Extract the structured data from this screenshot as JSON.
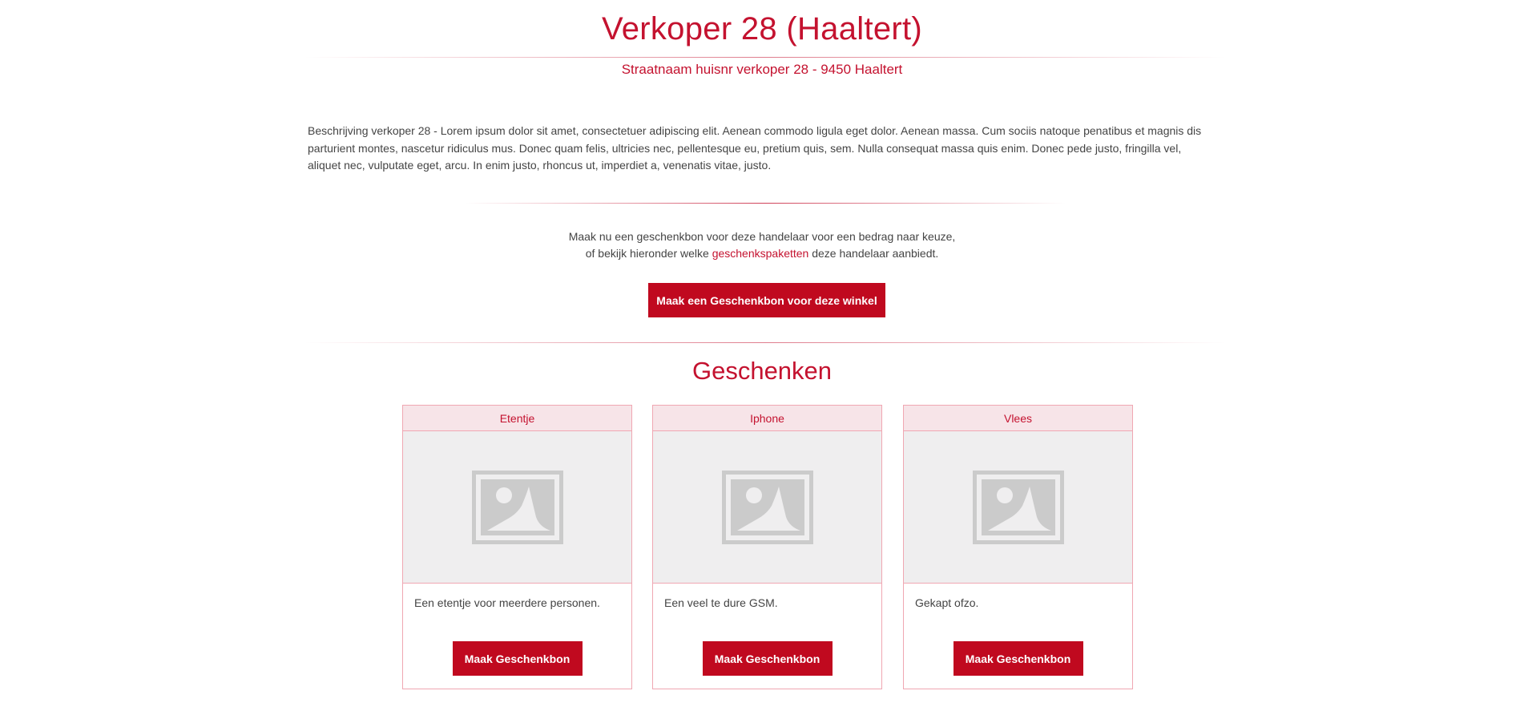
{
  "store": {
    "title": "Verkoper 28 (Haaltert)",
    "address": "Straatnaam huisnr verkoper 28 - 9450 Haaltert",
    "description": "Beschrijving verkoper 28 - Lorem ipsum dolor sit amet, consectetuer adipiscing elit. Aenean commodo ligula eget dolor. Aenean massa. Cum sociis natoque penatibus et magnis dis parturient montes, nascetur ridiculus mus. Donec quam felis, ultricies nec, pellentesque eu, pretium quis, sem. Nulla consequat massa quis enim. Donec pede justo, fringilla vel, aliquet nec, vulputate eget, arcu. In enim justo, rhoncus ut, imperdiet a, venenatis vitae, justo."
  },
  "cta": {
    "line1": "Maak nu een geschenkbon voor deze handelaar voor een bedrag naar keuze,",
    "line2_prefix": "of bekijk hieronder welke ",
    "line2_link": "geschenkspaketten",
    "line2_suffix": " deze handelaar aanbiedt.",
    "button_label": "Maak een Geschenkbon voor deze winkel"
  },
  "gifts": {
    "section_title": "Geschenken",
    "items": [
      {
        "title": "Etentje",
        "description": "Een etentje voor meerdere personen.",
        "image_icon": "image-placeholder-icon",
        "button_label": "Maak Geschenkbon"
      },
      {
        "title": "Iphone",
        "description": "Een veel te dure GSM.",
        "image_icon": "image-placeholder-icon",
        "button_label": "Maak Geschenkbon"
      },
      {
        "title": "Vlees",
        "description": "Gekapt ofzo.",
        "image_icon": "image-placeholder-icon",
        "button_label": "Maak Geschenkbon"
      }
    ]
  },
  "colors": {
    "accent": "#c4122f",
    "button": "#c0091f",
    "card_border": "#f0a7b2",
    "card_header_bg": "#f7e4e8",
    "image_bg": "#efeeef",
    "placeholder_icon": "#cbcbcb"
  }
}
